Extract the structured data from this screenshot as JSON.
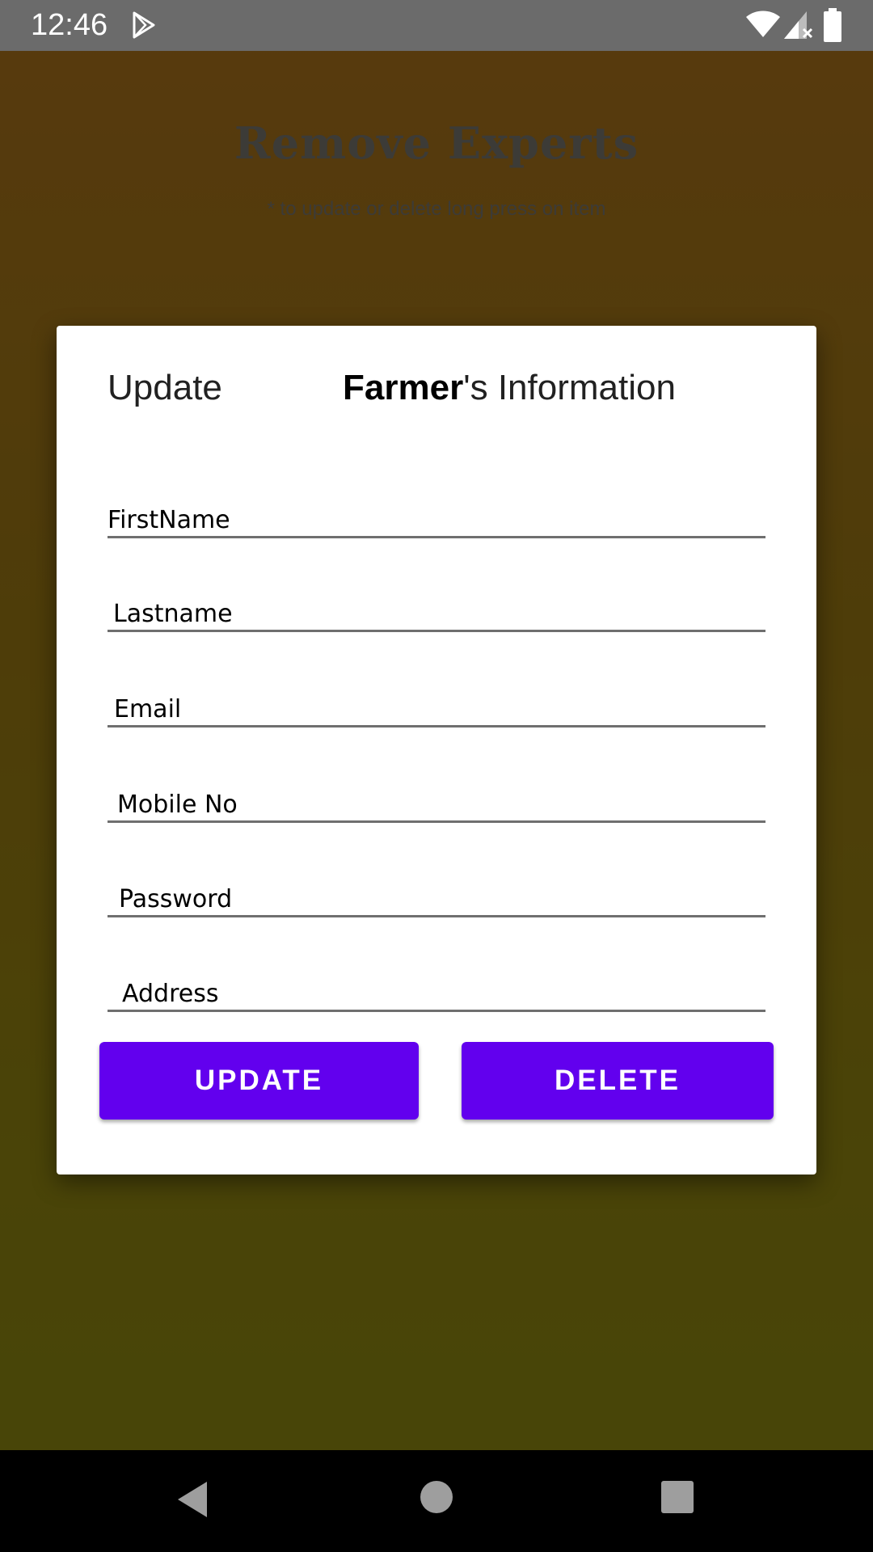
{
  "status_bar": {
    "time": "12:46",
    "icons": [
      "play-store-icon",
      "wifi-icon",
      "signal-icon",
      "battery-icon"
    ]
  },
  "background": {
    "title": "Remove Experts",
    "hint": "* to update or delete long press on item"
  },
  "dialog": {
    "action_label": "Update",
    "entity": "Farmer",
    "heading_suffix": "'s Information",
    "fields": {
      "first_name": {
        "value": "",
        "placeholder": "FirstName"
      },
      "last_name": {
        "value": "",
        "placeholder": "Lastname"
      },
      "email": {
        "value": "",
        "placeholder": "Email"
      },
      "mobile": {
        "value": "",
        "placeholder": "Mobile No"
      },
      "password": {
        "value": "",
        "placeholder": "Password"
      },
      "address": {
        "value": "",
        "placeholder": "Address"
      }
    },
    "buttons": {
      "update": "UPDATE",
      "delete": "DELETE"
    }
  },
  "colors": {
    "accent": "#6200ee",
    "status_bar": "#6b6b6b",
    "nav_bar": "#000000"
  },
  "nav_bar": {
    "icons": [
      "back-icon",
      "home-icon",
      "recents-icon"
    ]
  }
}
